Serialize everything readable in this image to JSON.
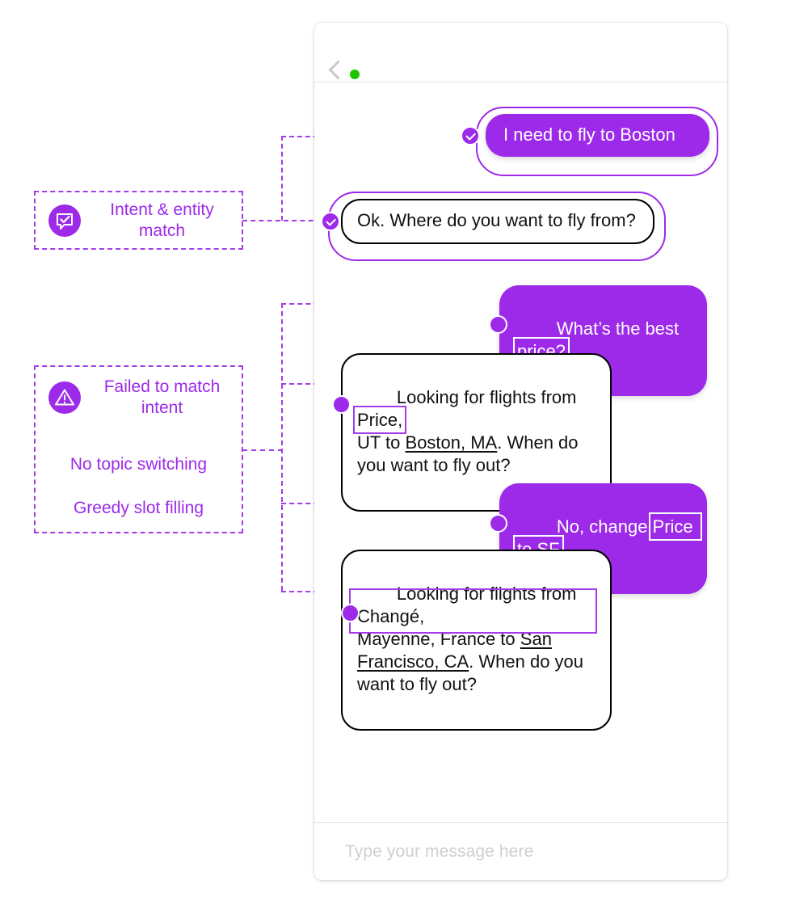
{
  "header": {
    "back_icon": "back-chevron-icon",
    "status_icon": "online-status-dot"
  },
  "composer": {
    "placeholder": "Type your message here",
    "value": ""
  },
  "messages": [
    {
      "id": "msg-1",
      "role": "user",
      "text": "I need to fly to Boston",
      "marker": "check",
      "highlighted": true
    },
    {
      "id": "msg-2",
      "role": "bot",
      "text": "Ok. Where do you want to fly from?",
      "marker": "check",
      "highlighted": true
    },
    {
      "id": "msg-3",
      "role": "user",
      "text_before": "What’s the best ",
      "text_boxed": "price?",
      "marker": "plain",
      "warning": true
    },
    {
      "id": "msg-4",
      "role": "bot",
      "text_a": "Looking for flights from ",
      "text_boxed": "Price,",
      "text_b": "\nUT to ",
      "text_underline": "Boston, MA",
      "text_c": ". When do\nyou want to fly out?",
      "marker": "plain"
    },
    {
      "id": "msg-5",
      "role": "user",
      "text_before": "No, change ",
      "text_boxed": "Price to SF",
      "marker": "plain",
      "warning": true
    },
    {
      "id": "msg-6",
      "role": "bot",
      "text_a": "Looking for flights from Changé,\nMayenne, France to ",
      "text_underline": "San\nFrancisco, CA",
      "text_c": ". When do you\nwant to fly out?",
      "marker": "plain"
    }
  ],
  "annotations": [
    {
      "id": "anno-success",
      "icon": "chat-check-icon",
      "title": "Intent & entity\nmatch",
      "lines": []
    },
    {
      "id": "anno-failure",
      "icon": "warning-triangle-icon",
      "title": "Failed to match\nintent",
      "lines": [
        "No topic switching",
        "Greedy slot filling"
      ]
    }
  ],
  "warnings": [
    {
      "id": "warn-1",
      "glyph": "!"
    },
    {
      "id": "warn-2",
      "glyph": "!"
    }
  ],
  "colors": {
    "purple": "#9d2ae8",
    "purple_line": "#a23ce8",
    "green": "#1fc400",
    "bot_border": "#000000",
    "placeholder": "#cfcfcf"
  }
}
